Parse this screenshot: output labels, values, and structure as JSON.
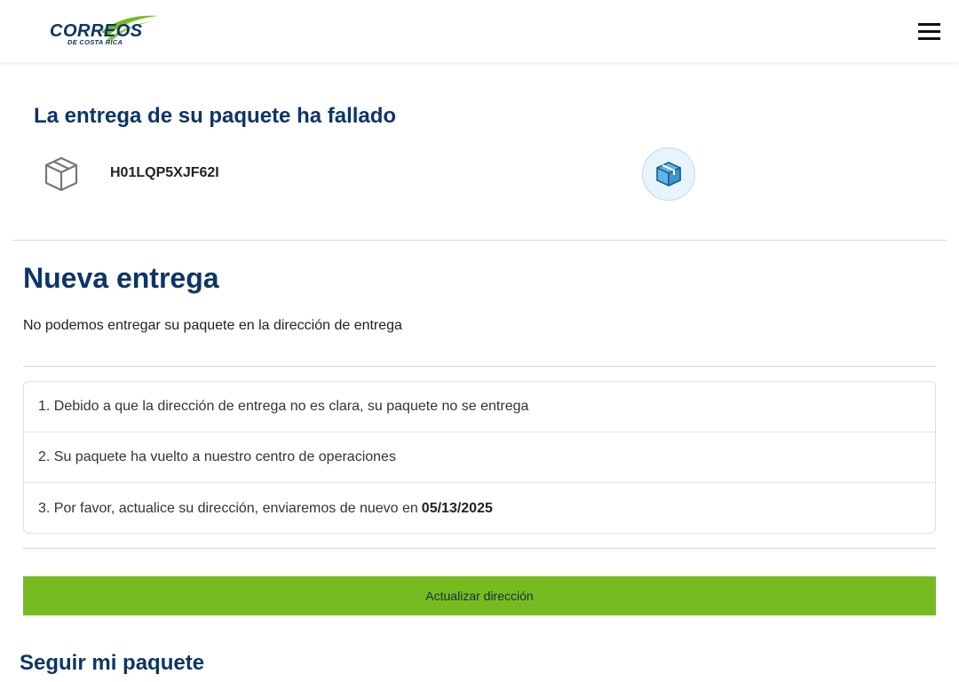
{
  "header": {
    "logo_word": "CORREOS",
    "logo_sub": "DE COSTA RICA"
  },
  "delivery": {
    "failed_title": "La entrega de su paquete ha fallado",
    "tracking_number": "H01LQP5XJF62I"
  },
  "new_delivery": {
    "title": "Nueva entrega",
    "description": "No podemos entregar su paquete en la dirección de entrega",
    "steps": [
      {
        "text": "1. Debido a que la dirección de entrega no es clara, su paquete no se entrega"
      },
      {
        "text": "2. Su paquete ha vuelto a nuestro centro de operaciones"
      },
      {
        "text": "3. Por favor, actualice su dirección, enviaremos de nuevo en",
        "date": "05/13/2025"
      }
    ],
    "update_button": "Actualizar dirección"
  },
  "track": {
    "title": "Seguir mi paquete"
  },
  "colors": {
    "brand_navy": "#0d3566",
    "brand_green": "#76bc21"
  },
  "icons": [
    "menu-icon",
    "package-outline-icon",
    "package-badge-icon"
  ]
}
